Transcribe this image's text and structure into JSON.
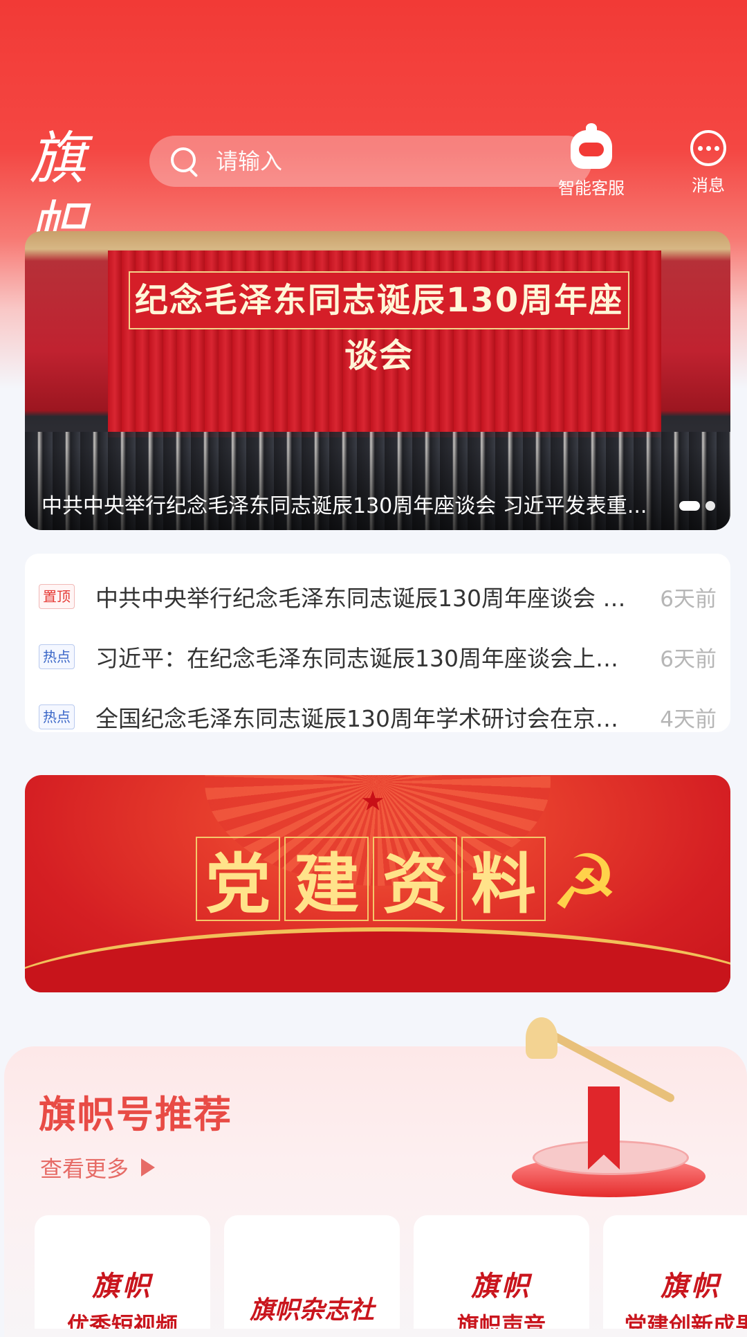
{
  "header": {
    "logo_text": "旗帜",
    "search_placeholder": "请输入",
    "customer_service_label": "智能客服",
    "messages_label": "消息"
  },
  "banner": {
    "sign_text": "纪念毛泽东同志诞辰130周年座谈会",
    "caption": "中共中央举行纪念毛泽东同志诞辰130周年座谈会 习近平发表重...",
    "slide_count": 2,
    "active_slide": 1
  },
  "news": [
    {
      "tag": "置顶",
      "tag_type": "pin",
      "title": "中共中央举行纪念毛泽东同志诞辰130周年座谈会 习...",
      "time": "6天前"
    },
    {
      "tag": "热点",
      "tag_type": "hot",
      "title": "习近平：在纪念毛泽东同志诞辰130周年座谈会上的...",
      "time": "6天前"
    },
    {
      "tag": "热点",
      "tag_type": "hot",
      "title": "全国纪念毛泽东同志诞辰130周年学术研讨会在京举行",
      "time": "4天前"
    }
  ],
  "party_banner": {
    "title_chars": [
      "党",
      "建",
      "资",
      "料"
    ]
  },
  "recommend": {
    "title": "旗帜号推荐",
    "more_label": "查看更多",
    "cards": [
      {
        "logo": "旗帜",
        "name": "优秀短视频"
      },
      {
        "logo": "",
        "name": "旗帜杂志社"
      },
      {
        "logo": "旗帜",
        "name": "旗帜声音"
      },
      {
        "logo": "旗帜",
        "name": "党建创新成果"
      }
    ]
  },
  "colors": {
    "brand_red": "#f23a36",
    "tag_pin": "#e53a35",
    "tag_hot": "#3a66c7",
    "recommend_title": "#e84b45"
  },
  "icons": {
    "search": "search-icon",
    "customer_service": "robot-icon",
    "messages": "chat-bubble-icon",
    "more": "triangle-right-icon"
  }
}
